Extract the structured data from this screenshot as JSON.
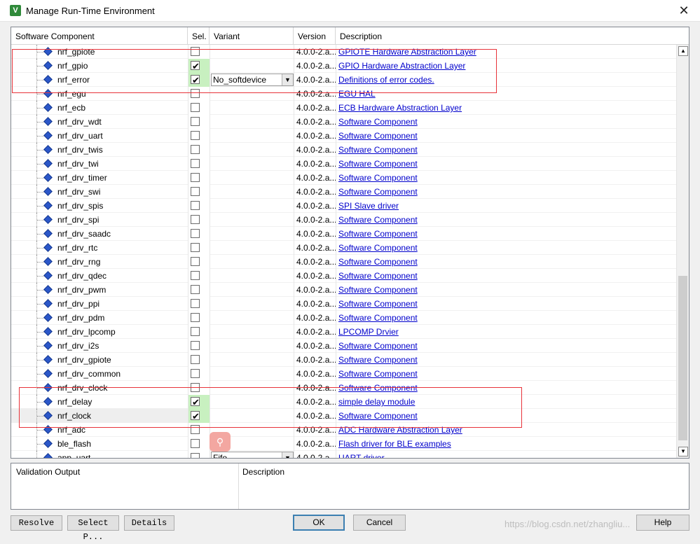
{
  "window": {
    "title": "Manage Run-Time Environment",
    "icon": "V",
    "close_label": "✕"
  },
  "grid": {
    "columns": [
      "Software Component",
      "Sel.",
      "Variant",
      "Version",
      "Description"
    ],
    "rows": [
      {
        "name": "nrf_gpiote",
        "checked": false,
        "variant": "",
        "version": "4.0.0-2.a...",
        "desc": "GPIOTE Hardware Abstraction Layer"
      },
      {
        "name": "nrf_gpio",
        "checked": true,
        "variant": "",
        "version": "4.0.0-2.a...",
        "desc": "GPIO Hardware Abstraction Layer"
      },
      {
        "name": "nrf_error",
        "checked": true,
        "variant": "No_softdevice",
        "version": "4.0.0-2.a...",
        "desc": "Definitions of error codes."
      },
      {
        "name": "nrf_egu",
        "checked": false,
        "variant": "",
        "version": "4.0.0-2.a...",
        "desc": "EGU HAL"
      },
      {
        "name": "nrf_ecb",
        "checked": false,
        "variant": "",
        "version": "4.0.0-2.a...",
        "desc": "ECB Hardware Abstraction Layer"
      },
      {
        "name": "nrf_drv_wdt",
        "checked": false,
        "variant": "",
        "version": "4.0.0-2.a...",
        "desc": "Software Component"
      },
      {
        "name": "nrf_drv_uart",
        "checked": false,
        "variant": "",
        "version": "4.0.0-2.a...",
        "desc": "Software Component"
      },
      {
        "name": "nrf_drv_twis",
        "checked": false,
        "variant": "",
        "version": "4.0.0-2.a...",
        "desc": "Software Component"
      },
      {
        "name": "nrf_drv_twi",
        "checked": false,
        "variant": "",
        "version": "4.0.0-2.a...",
        "desc": "Software Component"
      },
      {
        "name": "nrf_drv_timer",
        "checked": false,
        "variant": "",
        "version": "4.0.0-2.a...",
        "desc": "Software Component"
      },
      {
        "name": "nrf_drv_swi",
        "checked": false,
        "variant": "",
        "version": "4.0.0-2.a...",
        "desc": "Software Component"
      },
      {
        "name": "nrf_drv_spis",
        "checked": false,
        "variant": "",
        "version": "4.0.0-2.a...",
        "desc": "SPI Slave driver"
      },
      {
        "name": "nrf_drv_spi",
        "checked": false,
        "variant": "",
        "version": "4.0.0-2.a...",
        "desc": "Software Component"
      },
      {
        "name": "nrf_drv_saadc",
        "checked": false,
        "variant": "",
        "version": "4.0.0-2.a...",
        "desc": "Software Component"
      },
      {
        "name": "nrf_drv_rtc",
        "checked": false,
        "variant": "",
        "version": "4.0.0-2.a...",
        "desc": "Software Component"
      },
      {
        "name": "nrf_drv_rng",
        "checked": false,
        "variant": "",
        "version": "4.0.0-2.a...",
        "desc": "Software Component"
      },
      {
        "name": "nrf_drv_qdec",
        "checked": false,
        "variant": "",
        "version": "4.0.0-2.a...",
        "desc": "Software Component"
      },
      {
        "name": "nrf_drv_pwm",
        "checked": false,
        "variant": "",
        "version": "4.0.0-2.a...",
        "desc": "Software Component"
      },
      {
        "name": "nrf_drv_ppi",
        "checked": false,
        "variant": "",
        "version": "4.0.0-2.a...",
        "desc": "Software Component"
      },
      {
        "name": "nrf_drv_pdm",
        "checked": false,
        "variant": "",
        "version": "4.0.0-2.a...",
        "desc": "Software Component"
      },
      {
        "name": "nrf_drv_lpcomp",
        "checked": false,
        "variant": "",
        "version": "4.0.0-2.a...",
        "desc": "LPCOMP Drvier"
      },
      {
        "name": "nrf_drv_i2s",
        "checked": false,
        "variant": "",
        "version": "4.0.0-2.a...",
        "desc": "Software Component"
      },
      {
        "name": "nrf_drv_gpiote",
        "checked": false,
        "variant": "",
        "version": "4.0.0-2.a...",
        "desc": "Software Component"
      },
      {
        "name": "nrf_drv_common",
        "checked": false,
        "variant": "",
        "version": "4.0.0-2.a...",
        "desc": "Software Component"
      },
      {
        "name": "nrf_drv_clock",
        "checked": false,
        "variant": "",
        "version": "4.0.0-2.a...",
        "desc": "Software Component"
      },
      {
        "name": "nrf_delay",
        "checked": true,
        "variant": "",
        "version": "4.0.0-2.a...",
        "desc": "simple delay module"
      },
      {
        "name": "nrf_clock",
        "checked": true,
        "variant": "",
        "version": "4.0.0-2.a...",
        "desc": "Software Component"
      },
      {
        "name": "nrf_adc",
        "checked": false,
        "variant": "",
        "version": "4.0.0-2.a...",
        "desc": "ADC Hardware Abstraction Layer"
      },
      {
        "name": "ble_flash",
        "checked": false,
        "variant": "",
        "version": "4.0.0-2.a...",
        "desc": "Flash driver for BLE examples"
      },
      {
        "name": "app_uart",
        "checked": false,
        "variant": "Fifo",
        "version": "4.0.0-2.a...",
        "desc": "UART driver"
      }
    ]
  },
  "validation": {
    "col1": "Validation Output",
    "col2": "Description"
  },
  "buttons": {
    "resolve": "Resolve",
    "select_packs": "Select P...",
    "details": "Details",
    "ok": "OK",
    "cancel": "Cancel",
    "help": "Help"
  },
  "watermark": "https://blog.csdn.net/zhangliu...",
  "colors": {
    "selected_cell": "#c8f0c0",
    "link": "#0000cc",
    "annotation": "#e8333a"
  }
}
